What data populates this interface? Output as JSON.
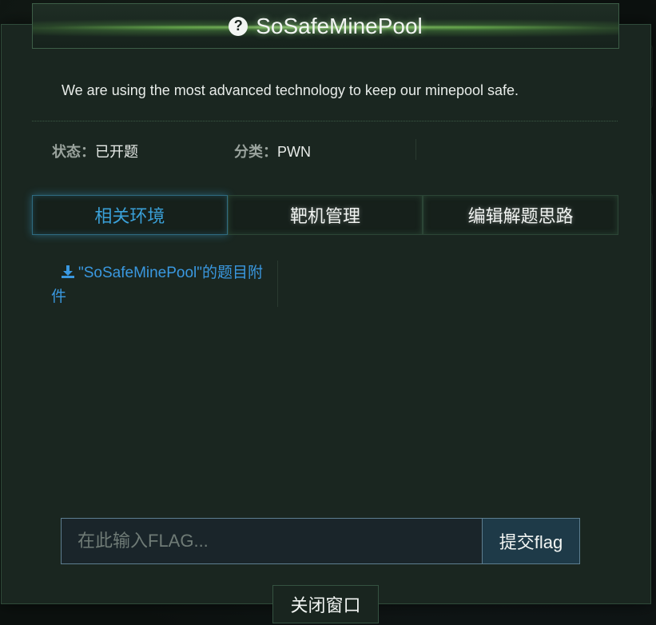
{
  "modal": {
    "title": "SoSafeMinePool",
    "description": "We are using the most advanced technology to keep our minepool safe.",
    "status_key": "状态：",
    "status_value": "已开题",
    "category_key": "分类：",
    "category_value": "PWN"
  },
  "tabs": [
    {
      "label": "相关环境",
      "active": true
    },
    {
      "label": "靶机管理",
      "active": false
    },
    {
      "label": "编辑解题思路",
      "active": false
    }
  ],
  "attachment": {
    "label": "\"SoSafeMinePool\"的题目附件",
    "icon": "download-icon"
  },
  "flag_form": {
    "placeholder": "在此输入FLAG...",
    "submit_label": "提交flag"
  },
  "close_label": "关闭窗口",
  "colors": {
    "accent_blue": "#3aa0d8",
    "panel_bg": "#1a2620",
    "border_green": "#2f4a3a"
  }
}
